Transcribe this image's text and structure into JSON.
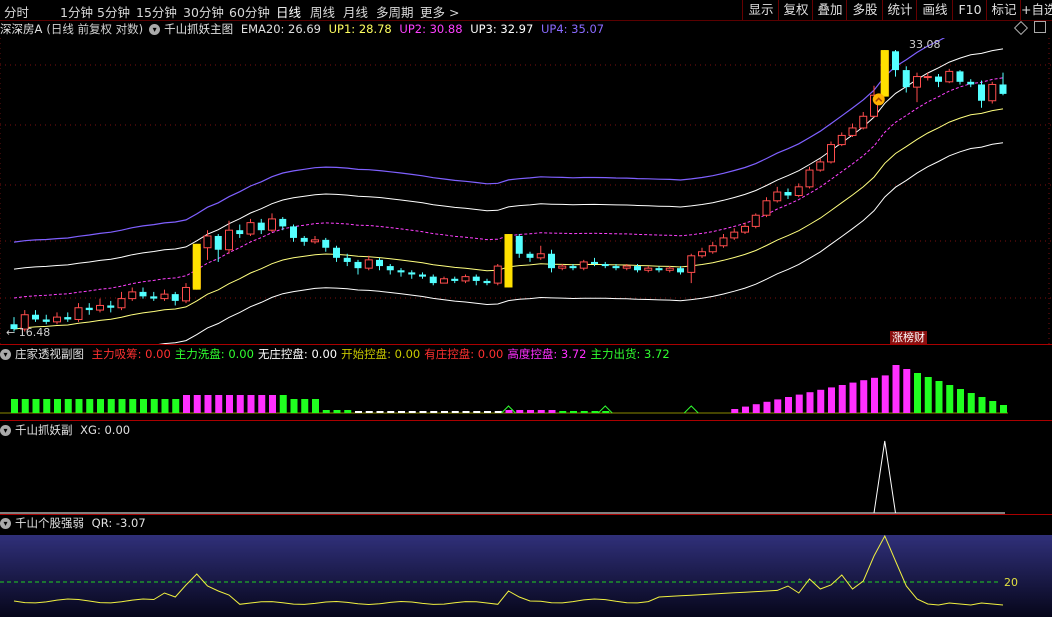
{
  "toolbar": {
    "period_tabs": [
      "分时",
      "1分钟",
      "5分钟",
      "15分钟",
      "30分钟",
      "60分钟",
      "日线",
      "周线",
      "月线",
      "多周期",
      "更多 >"
    ],
    "active_tab": "日线",
    "right_buttons": [
      "显示",
      "复权",
      "叠加",
      "多股",
      "统计",
      "画线",
      "F10",
      "标记",
      "+自选"
    ]
  },
  "main_header": {
    "stock": "深深房A",
    "mode": "(日线 前复权 对数)",
    "indicator": "千山抓妖主图",
    "ema20": "EMA20: 26.69",
    "up1": "UP1: 28.78",
    "up2": "UP2: 30.88",
    "up3": "UP3: 32.97",
    "up4": "UP4: 35.07"
  },
  "main_chart": {
    "high_label": "33.08",
    "low_label": "16.48",
    "badge": "涨榜财"
  },
  "sub1_header": {
    "name": "庄家透视副图",
    "items": [
      {
        "label": "主力吸筹:",
        "value": "0.00",
        "color": "#ff3030"
      },
      {
        "label": "主力洗盘:",
        "value": "0.00",
        "color": "#30ff30"
      },
      {
        "label": "无庄控盘:",
        "value": "0.00",
        "color": "#ffffff"
      },
      {
        "label": "开始控盘:",
        "value": "0.00",
        "color": "#c8c800"
      },
      {
        "label": "有庄控盘:",
        "value": "0.00",
        "color": "#ff3030"
      },
      {
        "label": "高度控盘:",
        "value": "3.72",
        "color": "#ff30ff"
      },
      {
        "label": "主力出货:",
        "value": "3.72",
        "color": "#30ff30"
      }
    ]
  },
  "sub2_header": {
    "name": "千山抓妖副",
    "value": "XG: 0.00"
  },
  "sub3_header": {
    "name": "千山个股强弱",
    "value": "QR: -3.07",
    "level_label": "20"
  },
  "colors": {
    "up": "#ff4d4d",
    "down": "#54ffff",
    "ema": "#ffff7f",
    "band": "#ffffff",
    "band_mid": "#ff40ff",
    "band_top": "#7f60ff"
  },
  "chart_data": {
    "type": "candlestick",
    "candles": [
      [
        16.8,
        16.6,
        17.1,
        16.5
      ],
      [
        16.6,
        17.2,
        17.4,
        16.5
      ],
      [
        17.2,
        17.0,
        17.4,
        16.9
      ],
      [
        17.0,
        16.9,
        17.2,
        16.8
      ],
      [
        16.9,
        17.1,
        17.3,
        16.8
      ],
      [
        17.1,
        17.0,
        17.3,
        16.9
      ],
      [
        17.0,
        17.5,
        17.7,
        16.9
      ],
      [
        17.5,
        17.4,
        17.7,
        17.2
      ],
      [
        17.4,
        17.6,
        17.9,
        17.3
      ],
      [
        17.6,
        17.5,
        17.8,
        17.3
      ],
      [
        17.5,
        17.9,
        18.2,
        17.4
      ],
      [
        17.9,
        18.2,
        18.4,
        17.8
      ],
      [
        18.2,
        18.0,
        18.4,
        17.9
      ],
      [
        18.0,
        17.9,
        18.2,
        17.8
      ],
      [
        17.9,
        18.1,
        18.3,
        17.8
      ],
      [
        18.1,
        17.8,
        18.2,
        17.6
      ],
      [
        17.8,
        18.4,
        18.6,
        17.7
      ],
      [
        18.4,
        20.3,
        20.5,
        18.3
      ],
      [
        20.3,
        20.9,
        21.2,
        19.7
      ],
      [
        20.9,
        20.2,
        21.0,
        19.6
      ],
      [
        20.2,
        21.2,
        21.7,
        20.0
      ],
      [
        21.2,
        21.0,
        21.5,
        20.8
      ],
      [
        21.0,
        21.6,
        21.8,
        20.9
      ],
      [
        21.6,
        21.2,
        21.8,
        21.0
      ],
      [
        21.2,
        21.8,
        22.1,
        21.1
      ],
      [
        21.8,
        21.4,
        21.9,
        21.2
      ],
      [
        21.4,
        20.8,
        21.5,
        20.6
      ],
      [
        20.8,
        20.6,
        20.9,
        20.4
      ],
      [
        20.6,
        20.7,
        20.9,
        20.5
      ],
      [
        20.7,
        20.3,
        20.8,
        20.1
      ],
      [
        20.3,
        19.8,
        20.4,
        19.6
      ],
      [
        19.8,
        19.6,
        20.0,
        19.4
      ],
      [
        19.6,
        19.3,
        19.7,
        19.0
      ],
      [
        19.3,
        19.7,
        19.9,
        19.2
      ],
      [
        19.7,
        19.4,
        19.8,
        19.2
      ],
      [
        19.4,
        19.2,
        19.5,
        19.0
      ],
      [
        19.2,
        19.1,
        19.3,
        18.9
      ],
      [
        19.1,
        19.0,
        19.2,
        18.8
      ],
      [
        19.0,
        18.9,
        19.1,
        18.8
      ],
      [
        18.9,
        18.6,
        19.0,
        18.5
      ],
      [
        18.6,
        18.8,
        18.9,
        18.6
      ],
      [
        18.8,
        18.7,
        18.9,
        18.6
      ],
      [
        18.7,
        18.9,
        19.0,
        18.6
      ],
      [
        18.9,
        18.7,
        19.0,
        18.5
      ],
      [
        18.7,
        18.6,
        18.8,
        18.5
      ],
      [
        18.6,
        19.4,
        19.5,
        18.5
      ],
      [
        19.4,
        20.9,
        21.0,
        18.4
      ],
      [
        20.9,
        20.0,
        21.0,
        19.8
      ],
      [
        20.0,
        19.8,
        20.1,
        19.6
      ],
      [
        19.8,
        20.0,
        20.4,
        19.7
      ],
      [
        20.0,
        19.3,
        20.2,
        19.1
      ],
      [
        19.3,
        19.4,
        19.5,
        19.2
      ],
      [
        19.4,
        19.3,
        19.5,
        19.2
      ],
      [
        19.3,
        19.6,
        19.7,
        19.2
      ],
      [
        19.6,
        19.5,
        19.8,
        19.4
      ],
      [
        19.5,
        19.4,
        19.6,
        19.3
      ],
      [
        19.4,
        19.3,
        19.5,
        19.2
      ],
      [
        19.3,
        19.4,
        19.5,
        19.2
      ],
      [
        19.4,
        19.2,
        19.5,
        19.1
      ],
      [
        19.2,
        19.3,
        19.4,
        19.1
      ],
      [
        19.3,
        19.2,
        19.4,
        19.1
      ],
      [
        19.2,
        19.3,
        19.4,
        19.1
      ],
      [
        19.3,
        19.1,
        19.4,
        19.0
      ],
      [
        19.1,
        19.9,
        20.0,
        18.6
      ],
      [
        19.9,
        20.1,
        20.3,
        19.8
      ],
      [
        20.1,
        20.4,
        20.6,
        20.0
      ],
      [
        20.4,
        20.8,
        21.0,
        20.3
      ],
      [
        20.8,
        21.1,
        21.3,
        20.7
      ],
      [
        21.1,
        21.4,
        21.6,
        21.0
      ],
      [
        21.4,
        22.0,
        22.1,
        21.3
      ],
      [
        22.0,
        22.8,
        23.0,
        21.9
      ],
      [
        22.8,
        23.3,
        23.6,
        22.7
      ],
      [
        23.3,
        23.1,
        23.5,
        22.9
      ],
      [
        23.1,
        23.6,
        23.8,
        23.0
      ],
      [
        23.6,
        24.6,
        24.8,
        23.5
      ],
      [
        24.6,
        25.1,
        25.3,
        24.5
      ],
      [
        25.1,
        26.2,
        26.4,
        25.0
      ],
      [
        26.2,
        26.8,
        27.0,
        26.1
      ],
      [
        26.8,
        27.3,
        27.6,
        26.7
      ],
      [
        27.3,
        28.1,
        28.4,
        27.2
      ],
      [
        28.1,
        29.6,
        30.3,
        28.0
      ],
      [
        29.6,
        33.0,
        33.1,
        29.5
      ],
      [
        33.0,
        31.5,
        33.1,
        31.0
      ],
      [
        31.5,
        30.2,
        31.8,
        29.8
      ],
      [
        30.2,
        31.0,
        31.3,
        29.1
      ],
      [
        31.0,
        31.0,
        31.3,
        30.7
      ],
      [
        31.0,
        30.6,
        31.2,
        30.2
      ],
      [
        30.6,
        31.4,
        31.6,
        30.5
      ],
      [
        31.4,
        30.6,
        31.5,
        30.4
      ],
      [
        30.6,
        30.4,
        30.8,
        30.2
      ],
      [
        30.4,
        29.2,
        30.7,
        28.7
      ],
      [
        29.2,
        30.4,
        30.6,
        29.0
      ],
      [
        30.4,
        29.7,
        31.3,
        29.6
      ]
    ],
    "yellow_bars": [
      17,
      46,
      81
    ],
    "ylim": [
      16.4,
      33.6
    ]
  }
}
